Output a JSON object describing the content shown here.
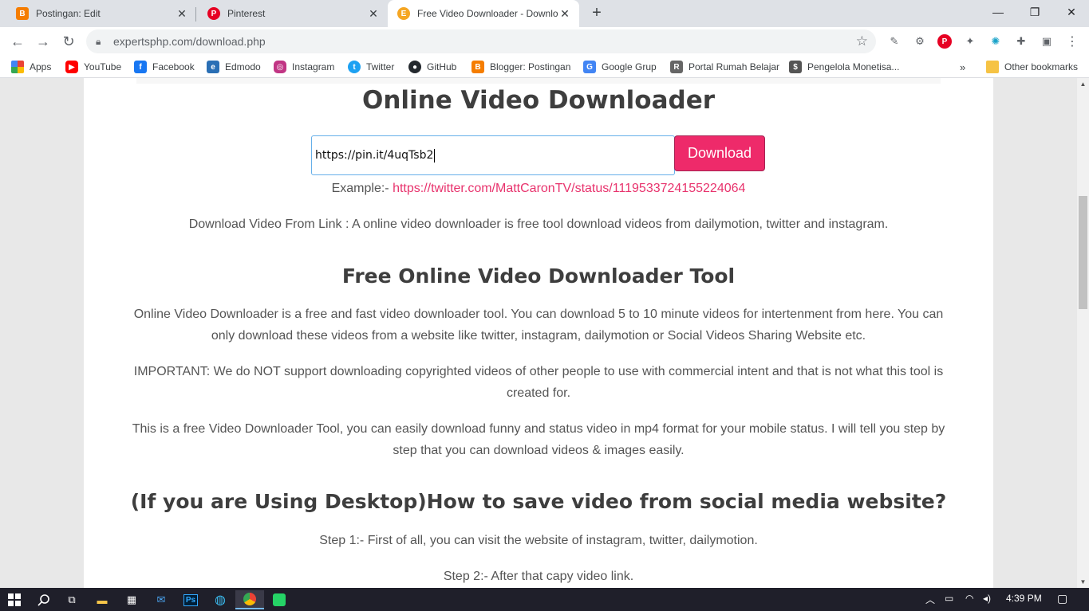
{
  "tabs": [
    {
      "title": "Postingan: Edit",
      "icon": "blogger-icon",
      "color": "#f57d00"
    },
    {
      "title": "Pinterest",
      "icon": "pinterest-icon",
      "color": "#e60023"
    },
    {
      "title": "Free Video Downloader - Downlo",
      "icon": "expertsphp-icon",
      "color": "#f5a623"
    }
  ],
  "address": {
    "url": "expertsphp.com/download.php"
  },
  "bookmarks": [
    {
      "label": "Apps",
      "icon": "apps-grid-icon"
    },
    {
      "label": "YouTube",
      "icon": "youtube-icon",
      "color": "#ff0000"
    },
    {
      "label": "Facebook",
      "icon": "facebook-icon",
      "color": "#1877f2"
    },
    {
      "label": "Edmodo",
      "icon": "edmodo-icon",
      "color": "#2a6fb5"
    },
    {
      "label": "Instagram",
      "icon": "instagram-icon",
      "color": "#c13584"
    },
    {
      "label": "Twitter",
      "icon": "twitter-icon",
      "color": "#1da1f2"
    },
    {
      "label": "GitHub",
      "icon": "github-icon",
      "color": "#24292e"
    },
    {
      "label": "Blogger: Postingan",
      "icon": "blogger-icon",
      "color": "#f57d00"
    },
    {
      "label": "Google Grup",
      "icon": "google-groups-icon",
      "color": "#4285f4"
    },
    {
      "label": "Portal Rumah Belajar",
      "icon": "rumah-belajar-icon",
      "color": "#666666"
    },
    {
      "label": "Pengelola Monetisa...",
      "icon": "monetization-icon",
      "color": "#555555"
    },
    {
      "label": "Other bookmarks",
      "icon": "folder-icon",
      "color": "#f6c344"
    }
  ],
  "page": {
    "title": "Online Video Downloader",
    "input_value": "https://pin.it/4uqTsb2",
    "download_label": "Download",
    "example_prefix": "Example:- ",
    "example_link": "https://twitter.com/MattCaronTV/status/1119533724155224064",
    "intro": "Download Video From Link : A online video downloader is free tool download videos from dailymotion, twitter and instagram.",
    "section1_title": "Free Online Video Downloader Tool",
    "p1": "Online Video Downloader is a free and fast video downloader tool. You can download 5 to 10 minute videos for intertenment from here. You can only download these videos from a website like twitter, instagram, dailymotion or Social Videos Sharing Website etc.",
    "p2": "IMPORTANT: We do NOT support downloading copyrighted videos of other people to use with commercial intent and that is not what this tool is created for.",
    "p3": "This is a free Video Downloader Tool, you can easily download funny and status video in mp4 format for your mobile status. I will tell you step by step that you can download videos & images easily.",
    "section2_title": "(If you are Using Desktop)How to save video from social media website?",
    "step1": "Step 1:- First of all, you can visit the website of instagram, twitter, dailymotion.",
    "step2": "Step 2:- After that capy video link."
  },
  "taskbar": {
    "time": "4:39 PM"
  },
  "colors": {
    "accent": "#ee2a6a",
    "link": "#e8336d"
  }
}
